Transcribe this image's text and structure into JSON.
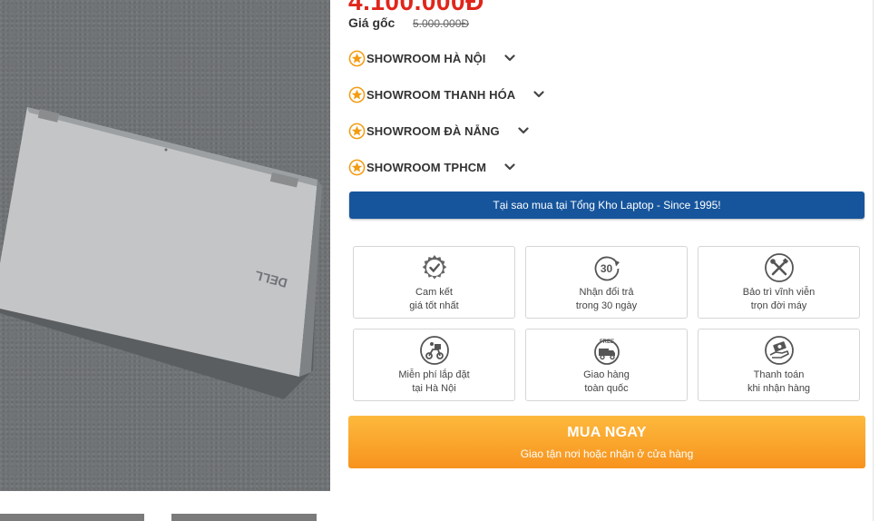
{
  "product": {
    "price": "4.100.000Đ",
    "original_price_label": "Giá gốc",
    "original_price": "5.000.000Đ"
  },
  "showrooms": [
    {
      "label": "SHOWROOM HÀ NỘI"
    },
    {
      "label": "SHOWROOM THANH HÓA"
    },
    {
      "label": "SHOWROOM ĐÀ NẴNG"
    },
    {
      "label": "SHOWROOM TPHCM"
    }
  ],
  "why_banner": "Tại sao mua tại Tổng Kho Laptop - Since 1995!",
  "features": [
    {
      "icon": "gear-check-icon",
      "line1": "Cam kết",
      "line2": "giá tốt nhất"
    },
    {
      "icon": "return-30-icon",
      "line1": "Nhận đổi trả",
      "line2": "trong 30 ngày"
    },
    {
      "icon": "tools-icon",
      "line1": "Bảo trì vĩnh viễn",
      "line2": "trọn đời máy"
    },
    {
      "icon": "delivery-scooter-icon",
      "line1": "Miễn phí lắp đặt",
      "line2": "tại Hà Nội"
    },
    {
      "icon": "free-shipping-icon",
      "line1": "Giao hàng",
      "line2": "toàn quốc"
    },
    {
      "icon": "cash-hand-icon",
      "line1": "Thanh toán",
      "line2": "khi nhận hàng"
    }
  ],
  "buy_button": {
    "label": "MUA NGAY",
    "sublabel": "Giao tận nơi hoặc nhận ở cửa hàng"
  },
  "colors": {
    "price_red": "#e0261b",
    "banner_blue": "#16559c",
    "buy_orange": "#f7931e",
    "star_orange": "#f39c12"
  },
  "photo": {
    "logo_text": "DELL"
  }
}
